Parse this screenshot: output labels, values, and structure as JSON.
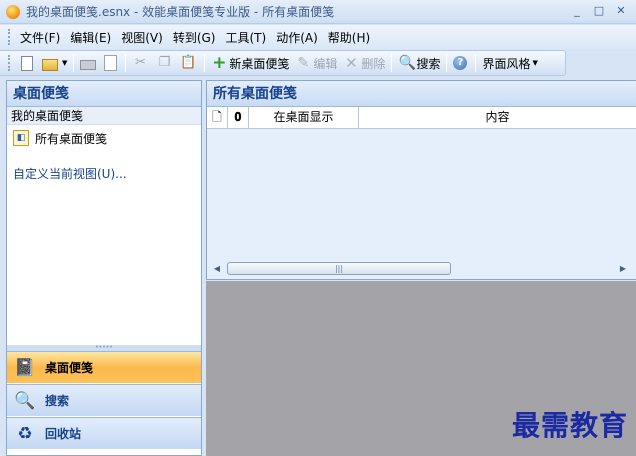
{
  "window": {
    "title": "我的桌面便笺.esnx - 效能桌面便笺专业版 - 所有桌面便笺",
    "controls": [
      "_",
      "□",
      "✕"
    ]
  },
  "menu": [
    "文件(F)",
    "编辑(E)",
    "视图(V)",
    "转到(G)",
    "工具(T)",
    "动作(A)",
    "帮助(H)"
  ],
  "toolbar": {
    "new_note": "新桌面便笺",
    "edit": "编辑",
    "delete": "删除",
    "search": "搜索",
    "help": "?",
    "theme": "界面风格"
  },
  "left_pane": {
    "header": "桌面便笺",
    "group_label": "我的桌面便笺",
    "folder": "所有桌面便笺",
    "custom_view": "自定义当前视图(U)...",
    "nav": [
      "桌面便笺",
      "搜索",
      "回收站"
    ]
  },
  "right_pane": {
    "header": "所有桌面便笺",
    "columns": [
      "",
      "",
      "在桌面显示",
      "内容"
    ]
  },
  "watermark": "最需教育"
}
